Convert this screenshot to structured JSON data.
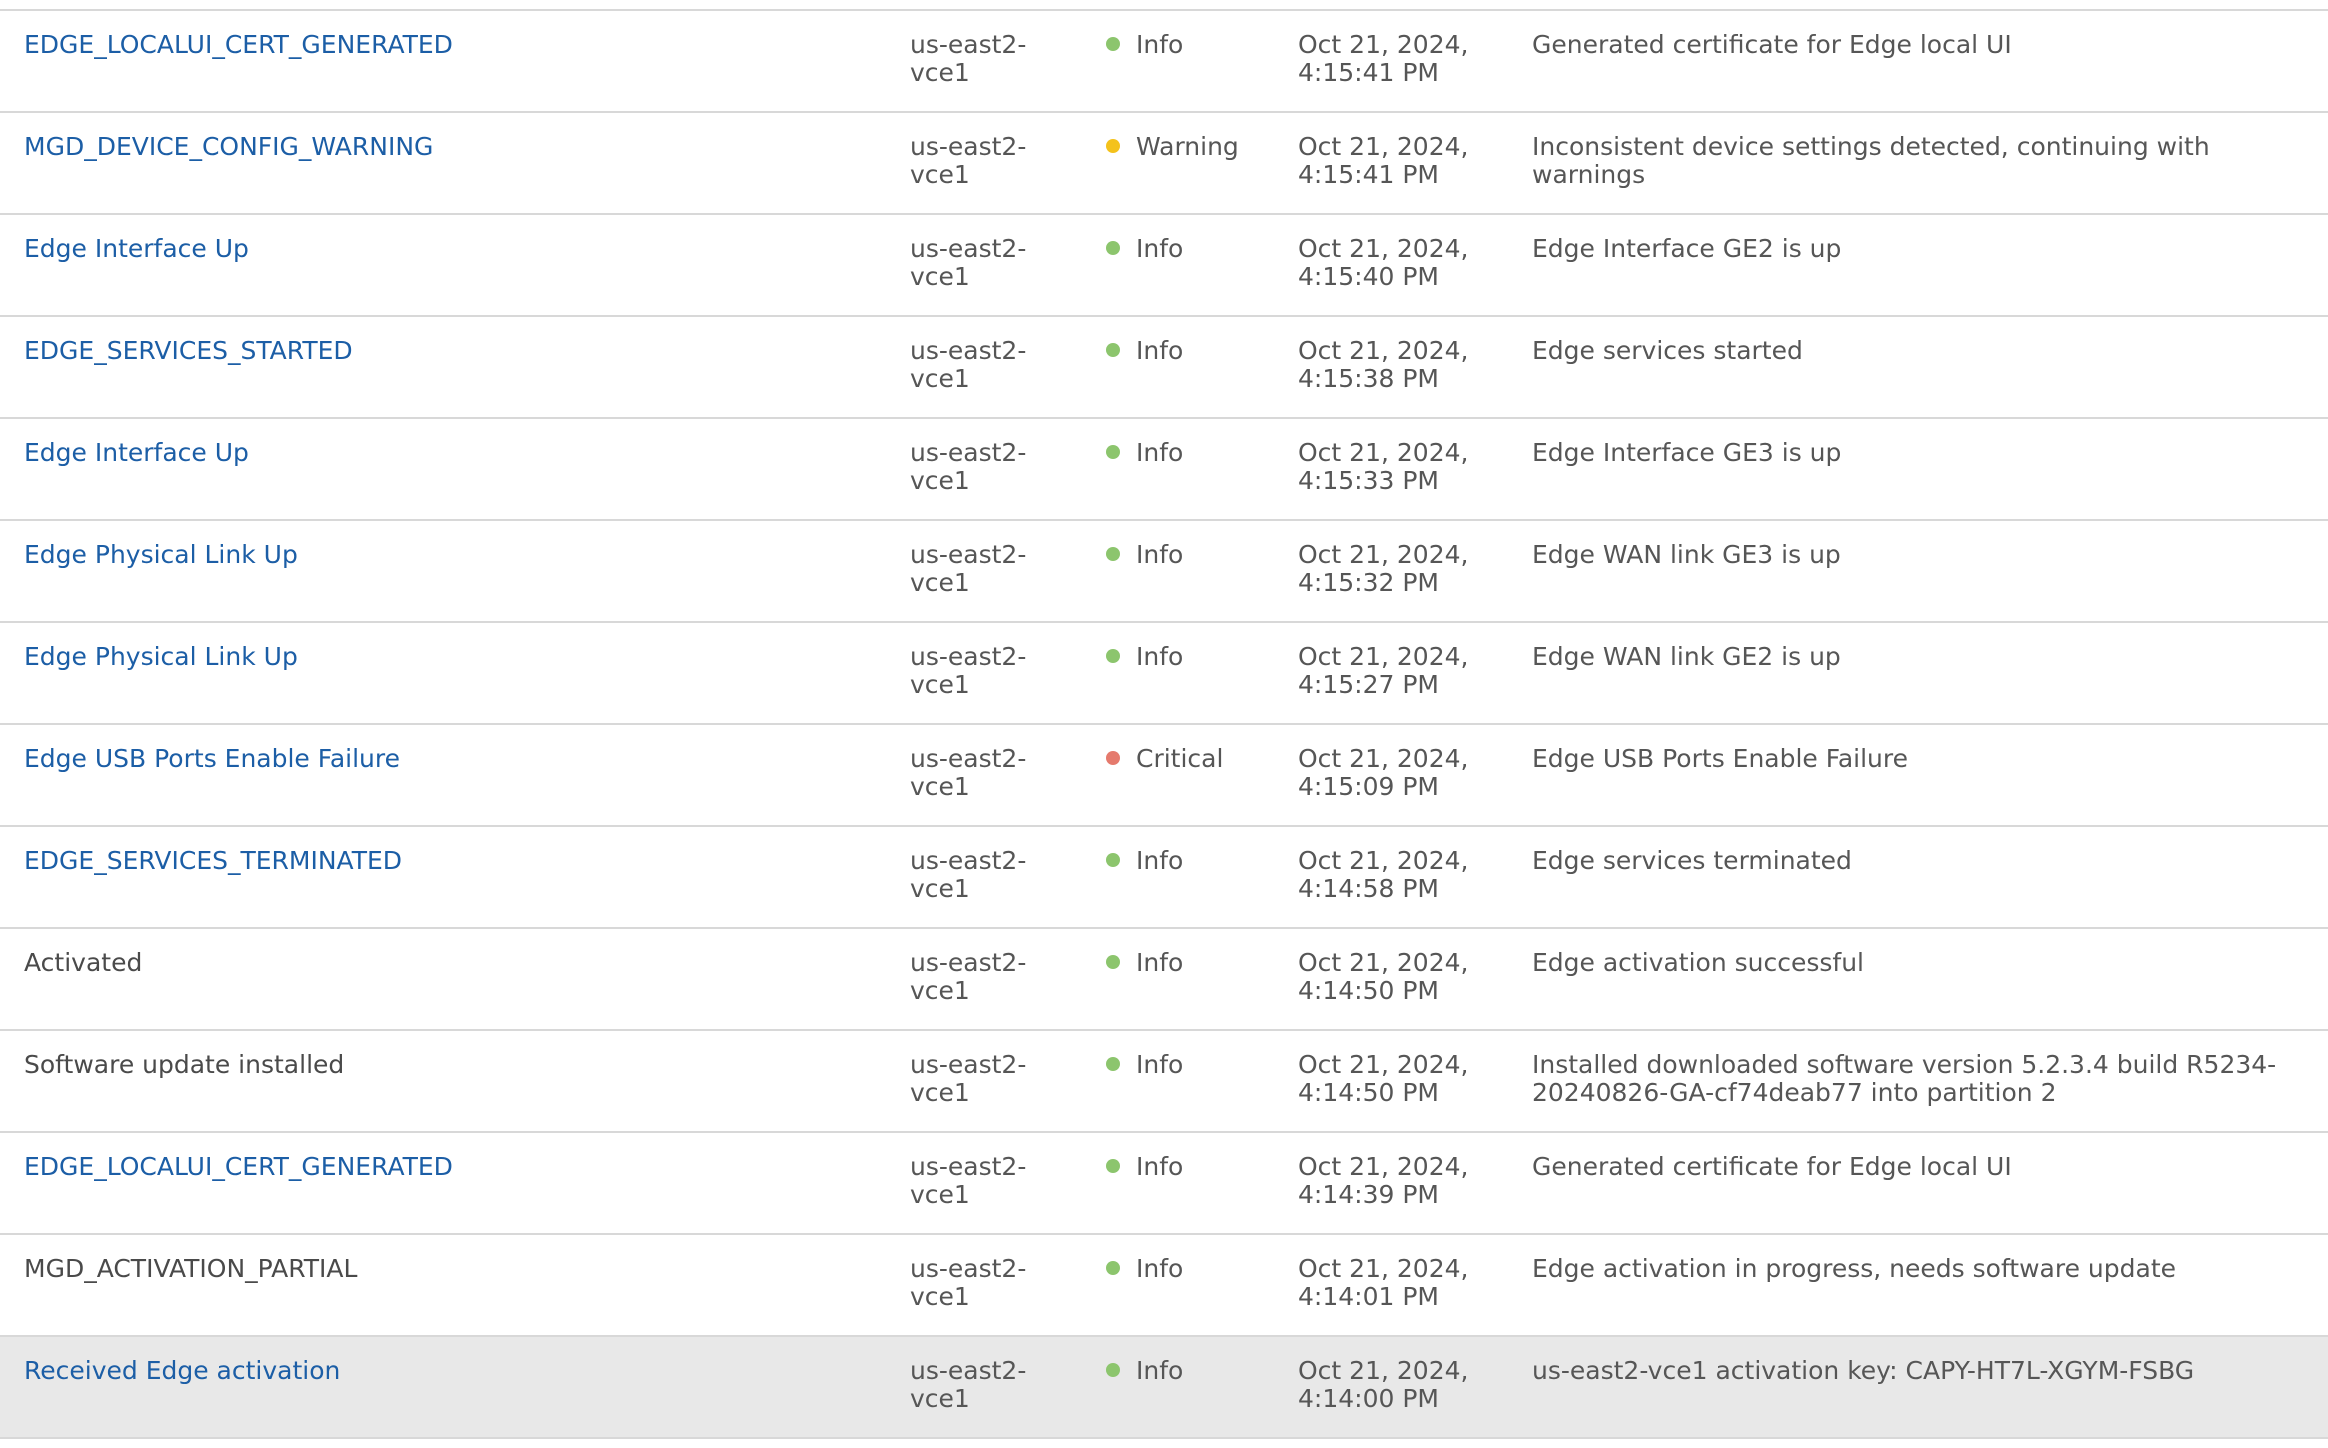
{
  "colors": {
    "link": "#1c5ea6",
    "info": "#8cc56d",
    "warning": "#f4c21b",
    "critical": "#e57a6d",
    "selected_row": "#e8e8e8",
    "divider": "#d8d8d8"
  },
  "events": [
    {
      "event": "EDGE_LOCALUI_CERT_GENERATED",
      "link": true,
      "edge": "us-east2-\nvce1",
      "severity": "Info",
      "severity_level": "info",
      "time": "Oct 21, 2024,\n4:15:41 PM",
      "message": "Generated certificate for Edge local UI"
    },
    {
      "event": "MGD_DEVICE_CONFIG_WARNING",
      "link": true,
      "edge": "us-east2-\nvce1",
      "severity": "Warning",
      "severity_level": "warning",
      "time": "Oct 21, 2024,\n4:15:41 PM",
      "message": "Inconsistent device settings detected, continuing with warnings"
    },
    {
      "event": "Edge Interface Up",
      "link": true,
      "edge": "us-east2-\nvce1",
      "severity": "Info",
      "severity_level": "info",
      "time": "Oct 21, 2024,\n4:15:40 PM",
      "message": "Edge Interface GE2 is up"
    },
    {
      "event": "EDGE_SERVICES_STARTED",
      "link": true,
      "edge": "us-east2-\nvce1",
      "severity": "Info",
      "severity_level": "info",
      "time": "Oct 21, 2024,\n4:15:38 PM",
      "message": "Edge services started"
    },
    {
      "event": "Edge Interface Up",
      "link": true,
      "edge": "us-east2-\nvce1",
      "severity": "Info",
      "severity_level": "info",
      "time": "Oct 21, 2024,\n4:15:33 PM",
      "message": "Edge Interface GE3 is up"
    },
    {
      "event": "Edge Physical Link Up",
      "link": true,
      "edge": "us-east2-\nvce1",
      "severity": "Info",
      "severity_level": "info",
      "time": "Oct 21, 2024,\n4:15:32 PM",
      "message": "Edge WAN link GE3 is up"
    },
    {
      "event": "Edge Physical Link Up",
      "link": true,
      "edge": "us-east2-\nvce1",
      "severity": "Info",
      "severity_level": "info",
      "time": "Oct 21, 2024,\n4:15:27 PM",
      "message": "Edge WAN link GE2 is up"
    },
    {
      "event": "Edge USB Ports Enable Failure",
      "link": true,
      "edge": "us-east2-\nvce1",
      "severity": "Critical",
      "severity_level": "critical",
      "time": "Oct 21, 2024,\n4:15:09 PM",
      "message": "Edge USB Ports Enable Failure"
    },
    {
      "event": "EDGE_SERVICES_TERMINATED",
      "link": true,
      "edge": "us-east2-\nvce1",
      "severity": "Info",
      "severity_level": "info",
      "time": "Oct 21, 2024,\n4:14:58 PM",
      "message": "Edge services terminated"
    },
    {
      "event": "Activated",
      "link": false,
      "edge": "us-east2-\nvce1",
      "severity": "Info",
      "severity_level": "info",
      "time": "Oct 21, 2024,\n4:14:50 PM",
      "message": "Edge activation successful"
    },
    {
      "event": "Software update installed",
      "link": false,
      "edge": "us-east2-\nvce1",
      "severity": "Info",
      "severity_level": "info",
      "time": "Oct 21, 2024,\n4:14:50 PM",
      "message": "Installed downloaded software version 5.2.3.4 build R5234-\n20240826-GA-cf74deab77 into partition 2"
    },
    {
      "event": "EDGE_LOCALUI_CERT_GENERATED",
      "link": true,
      "edge": "us-east2-\nvce1",
      "severity": "Info",
      "severity_level": "info",
      "time": "Oct 21, 2024,\n4:14:39 PM",
      "message": "Generated certificate for Edge local UI"
    },
    {
      "event": "MGD_ACTIVATION_PARTIAL",
      "link": false,
      "edge": "us-east2-\nvce1",
      "severity": "Info",
      "severity_level": "info",
      "time": "Oct 21, 2024,\n4:14:01 PM",
      "message": "Edge activation in progress, needs software update"
    },
    {
      "event": "Received Edge activation",
      "link": true,
      "selected": true,
      "edge": "us-east2-\nvce1",
      "severity": "Info",
      "severity_level": "info",
      "time": "Oct 21, 2024,\n4:14:00 PM",
      "message": "us-east2-vce1 activation key: CAPY-HT7L-XGYM-FSBG"
    }
  ]
}
